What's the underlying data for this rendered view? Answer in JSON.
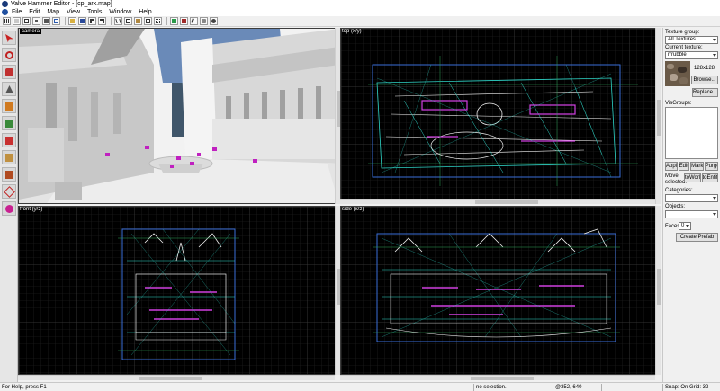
{
  "window": {
    "title": "Valve Hammer Editor - [cp_arx.map]"
  },
  "menu": [
    "File",
    "Edit",
    "Map",
    "View",
    "Tools",
    "Window",
    "Help"
  ],
  "toolbar": {
    "buttons": [
      "grid-icon",
      "grid-dots-icon",
      "grid-toggle-icon",
      "grid-smaller-icon",
      "grid-larger-icon",
      "3d-grid-icon",
      "open-icon",
      "save-icon",
      "undo-icon",
      "redo-icon",
      "cut-icon",
      "copy-icon",
      "paste-icon",
      "group-icon",
      "ungroup-icon",
      "hide-icon",
      "show-icon",
      "carve-icon",
      "texture-lock-icon",
      "run-icon"
    ]
  },
  "tools": [
    "selection-tool-icon",
    "magnify-tool-icon",
    "camera-tool-icon",
    "entity-tool-icon",
    "block-tool-icon",
    "texture-tool-icon",
    "apply-texture-icon",
    "decal-tool-icon",
    "clipping-tool-icon",
    "vertex-tool-icon",
    "path-tool-icon"
  ],
  "viewports": {
    "camera": "camera",
    "top": "top (x/y)",
    "front": "front (y/z)",
    "side": "side (x/z)"
  },
  "panel": {
    "texture_group_label": "Texture group:",
    "texture_group_value": "All Textures",
    "current_texture_label": "Current texture:",
    "current_texture_value": "rrrubble",
    "texture_size": "128x128",
    "browse": "Browse...",
    "replace": "Replace...",
    "visgroups_label": "VisGroups:",
    "apply": "Apply",
    "edit": "Edit",
    "mark": "Mark",
    "purge": "Purge",
    "move_selected_label": "Move selected:",
    "to_world": "toWorld",
    "to_entity": "toEntity",
    "categories_label": "Categories:",
    "objects_label": "Objects:",
    "faces_label": "Faces:",
    "faces_value": "0",
    "create_prefab": "Create Prefab"
  },
  "status": {
    "help": "For Help, press F1",
    "selection": "no selection.",
    "coords": "@352, 640",
    "snap": "Snap: On Grid: 32"
  },
  "colors": {
    "viewport_bg": "#000000",
    "grid_minor": "#262626",
    "grid_major": "#3c3c3c",
    "brush_cyan": "#2fd6c8",
    "brush_white": "#f0f0f0",
    "brush_magenta": "#d040e0",
    "brush_green": "#2ea45a",
    "selection_blue": "#3a6ed8"
  }
}
